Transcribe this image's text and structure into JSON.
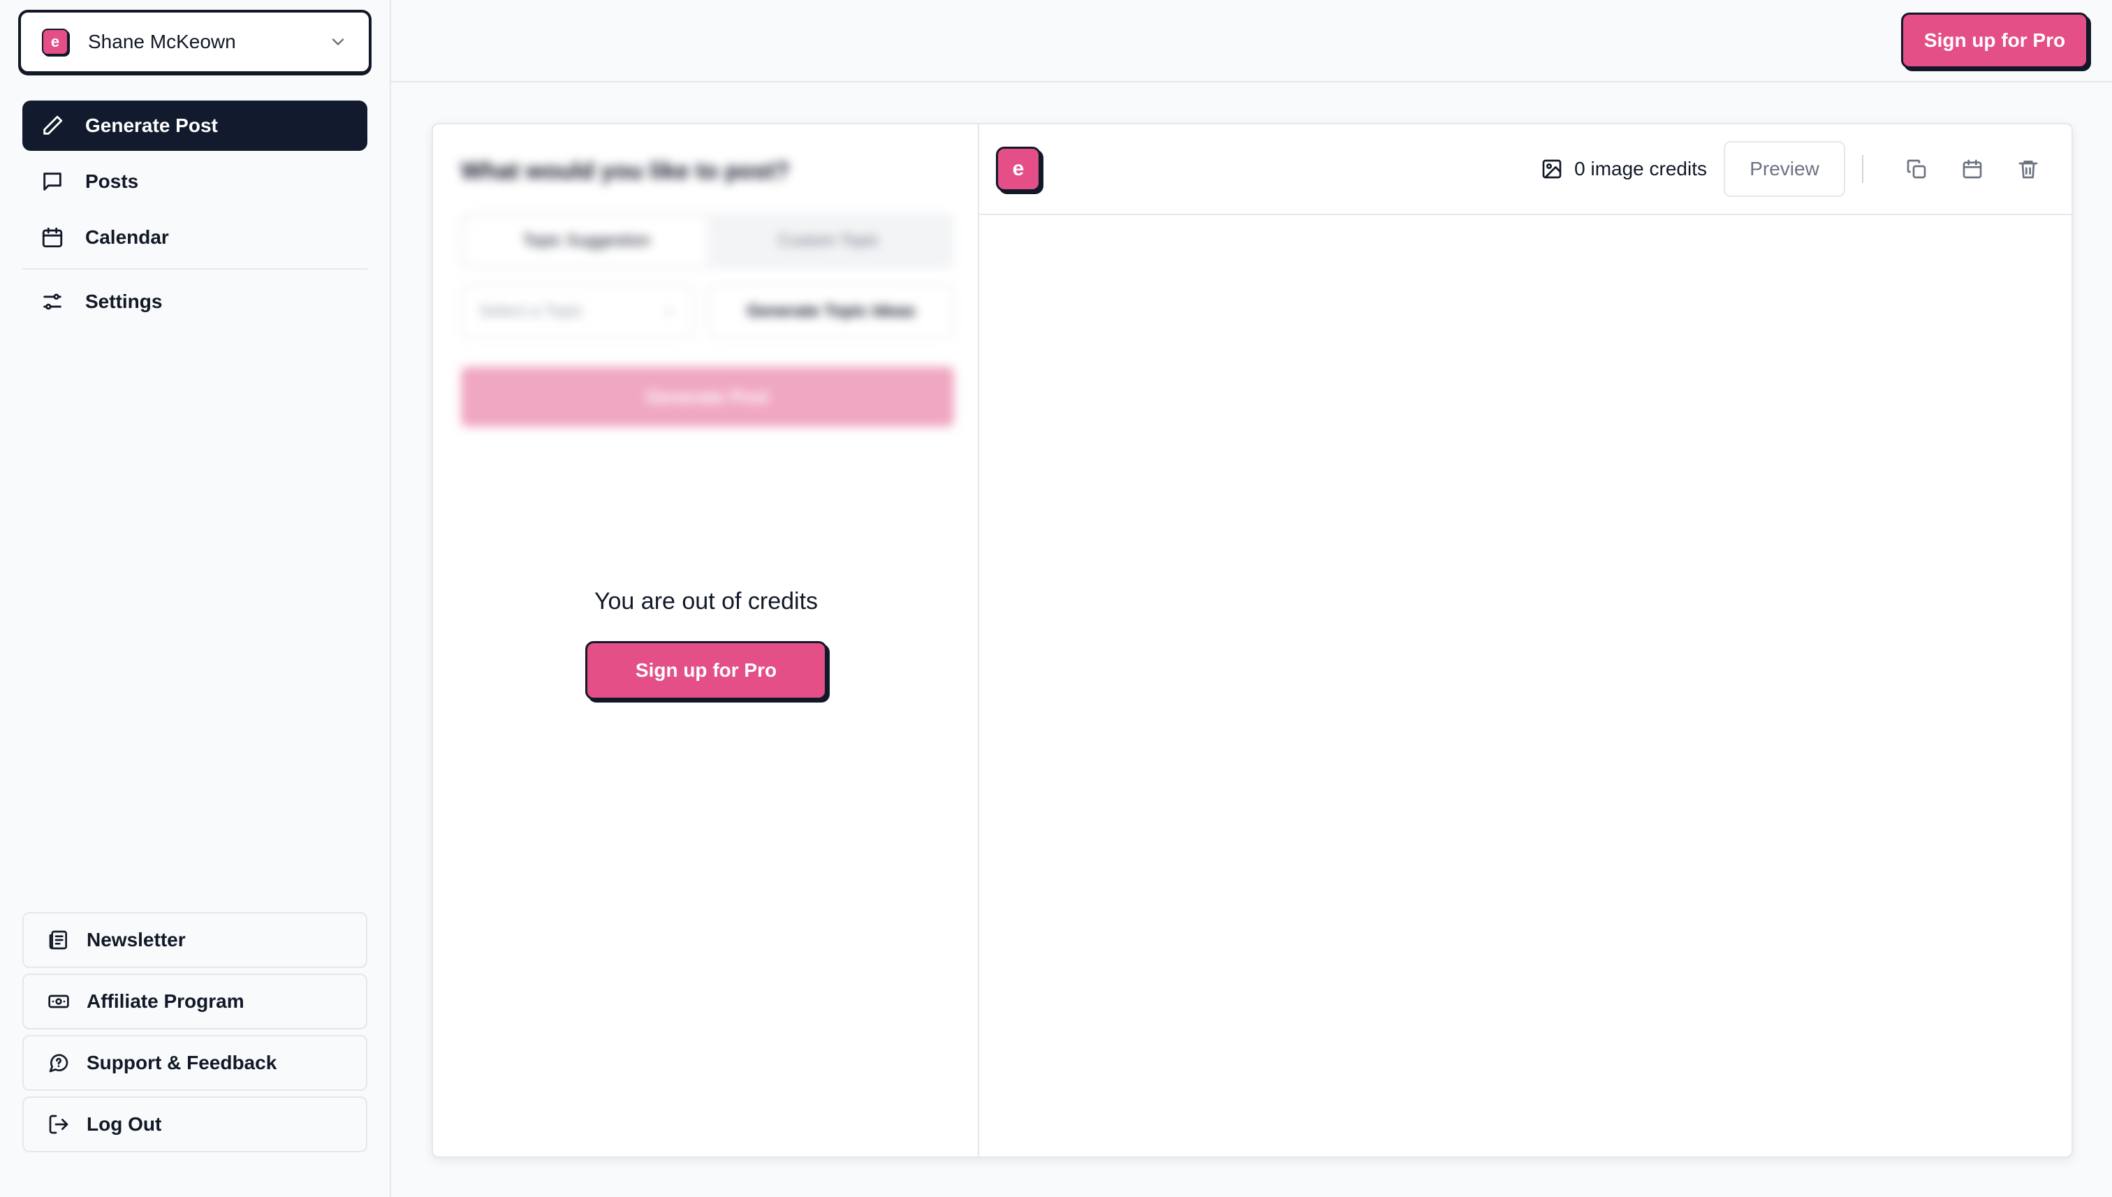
{
  "account": {
    "initial": "e",
    "name": "Shane McKeown"
  },
  "nav": {
    "items": [
      {
        "label": "Generate Post",
        "icon": "pencil-icon",
        "active": true
      },
      {
        "label": "Posts",
        "icon": "message-icon"
      },
      {
        "label": "Calendar",
        "icon": "calendar-icon"
      }
    ],
    "settings": {
      "label": "Settings",
      "icon": "sliders-icon"
    }
  },
  "bottom_links": [
    {
      "label": "Newsletter",
      "icon": "newspaper-icon"
    },
    {
      "label": "Affiliate Program",
      "icon": "banknote-icon"
    },
    {
      "label": "Support & Feedback",
      "icon": "chat-help-icon"
    },
    {
      "label": "Log Out",
      "icon": "logout-icon"
    }
  ],
  "topbar": {
    "pro_label": "Sign up for Pro"
  },
  "composer": {
    "title": "What would you like to post?",
    "tabs": [
      "Topic Suggestion",
      "Custom Topic"
    ],
    "select_placeholder": "Select a Topic",
    "generate_ideas_label": "Generate Topic Ideas",
    "generate_post_label": "Generate Post",
    "out_of_credits": "You are out of credits",
    "pro_label": "Sign up for Pro"
  },
  "preview_panel": {
    "logo_initial": "e",
    "image_credits": "0 image credits",
    "preview_label": "Preview"
  },
  "colors": {
    "brand": "#e34f86",
    "dark": "#121a2e",
    "border": "#e5e7eb"
  }
}
